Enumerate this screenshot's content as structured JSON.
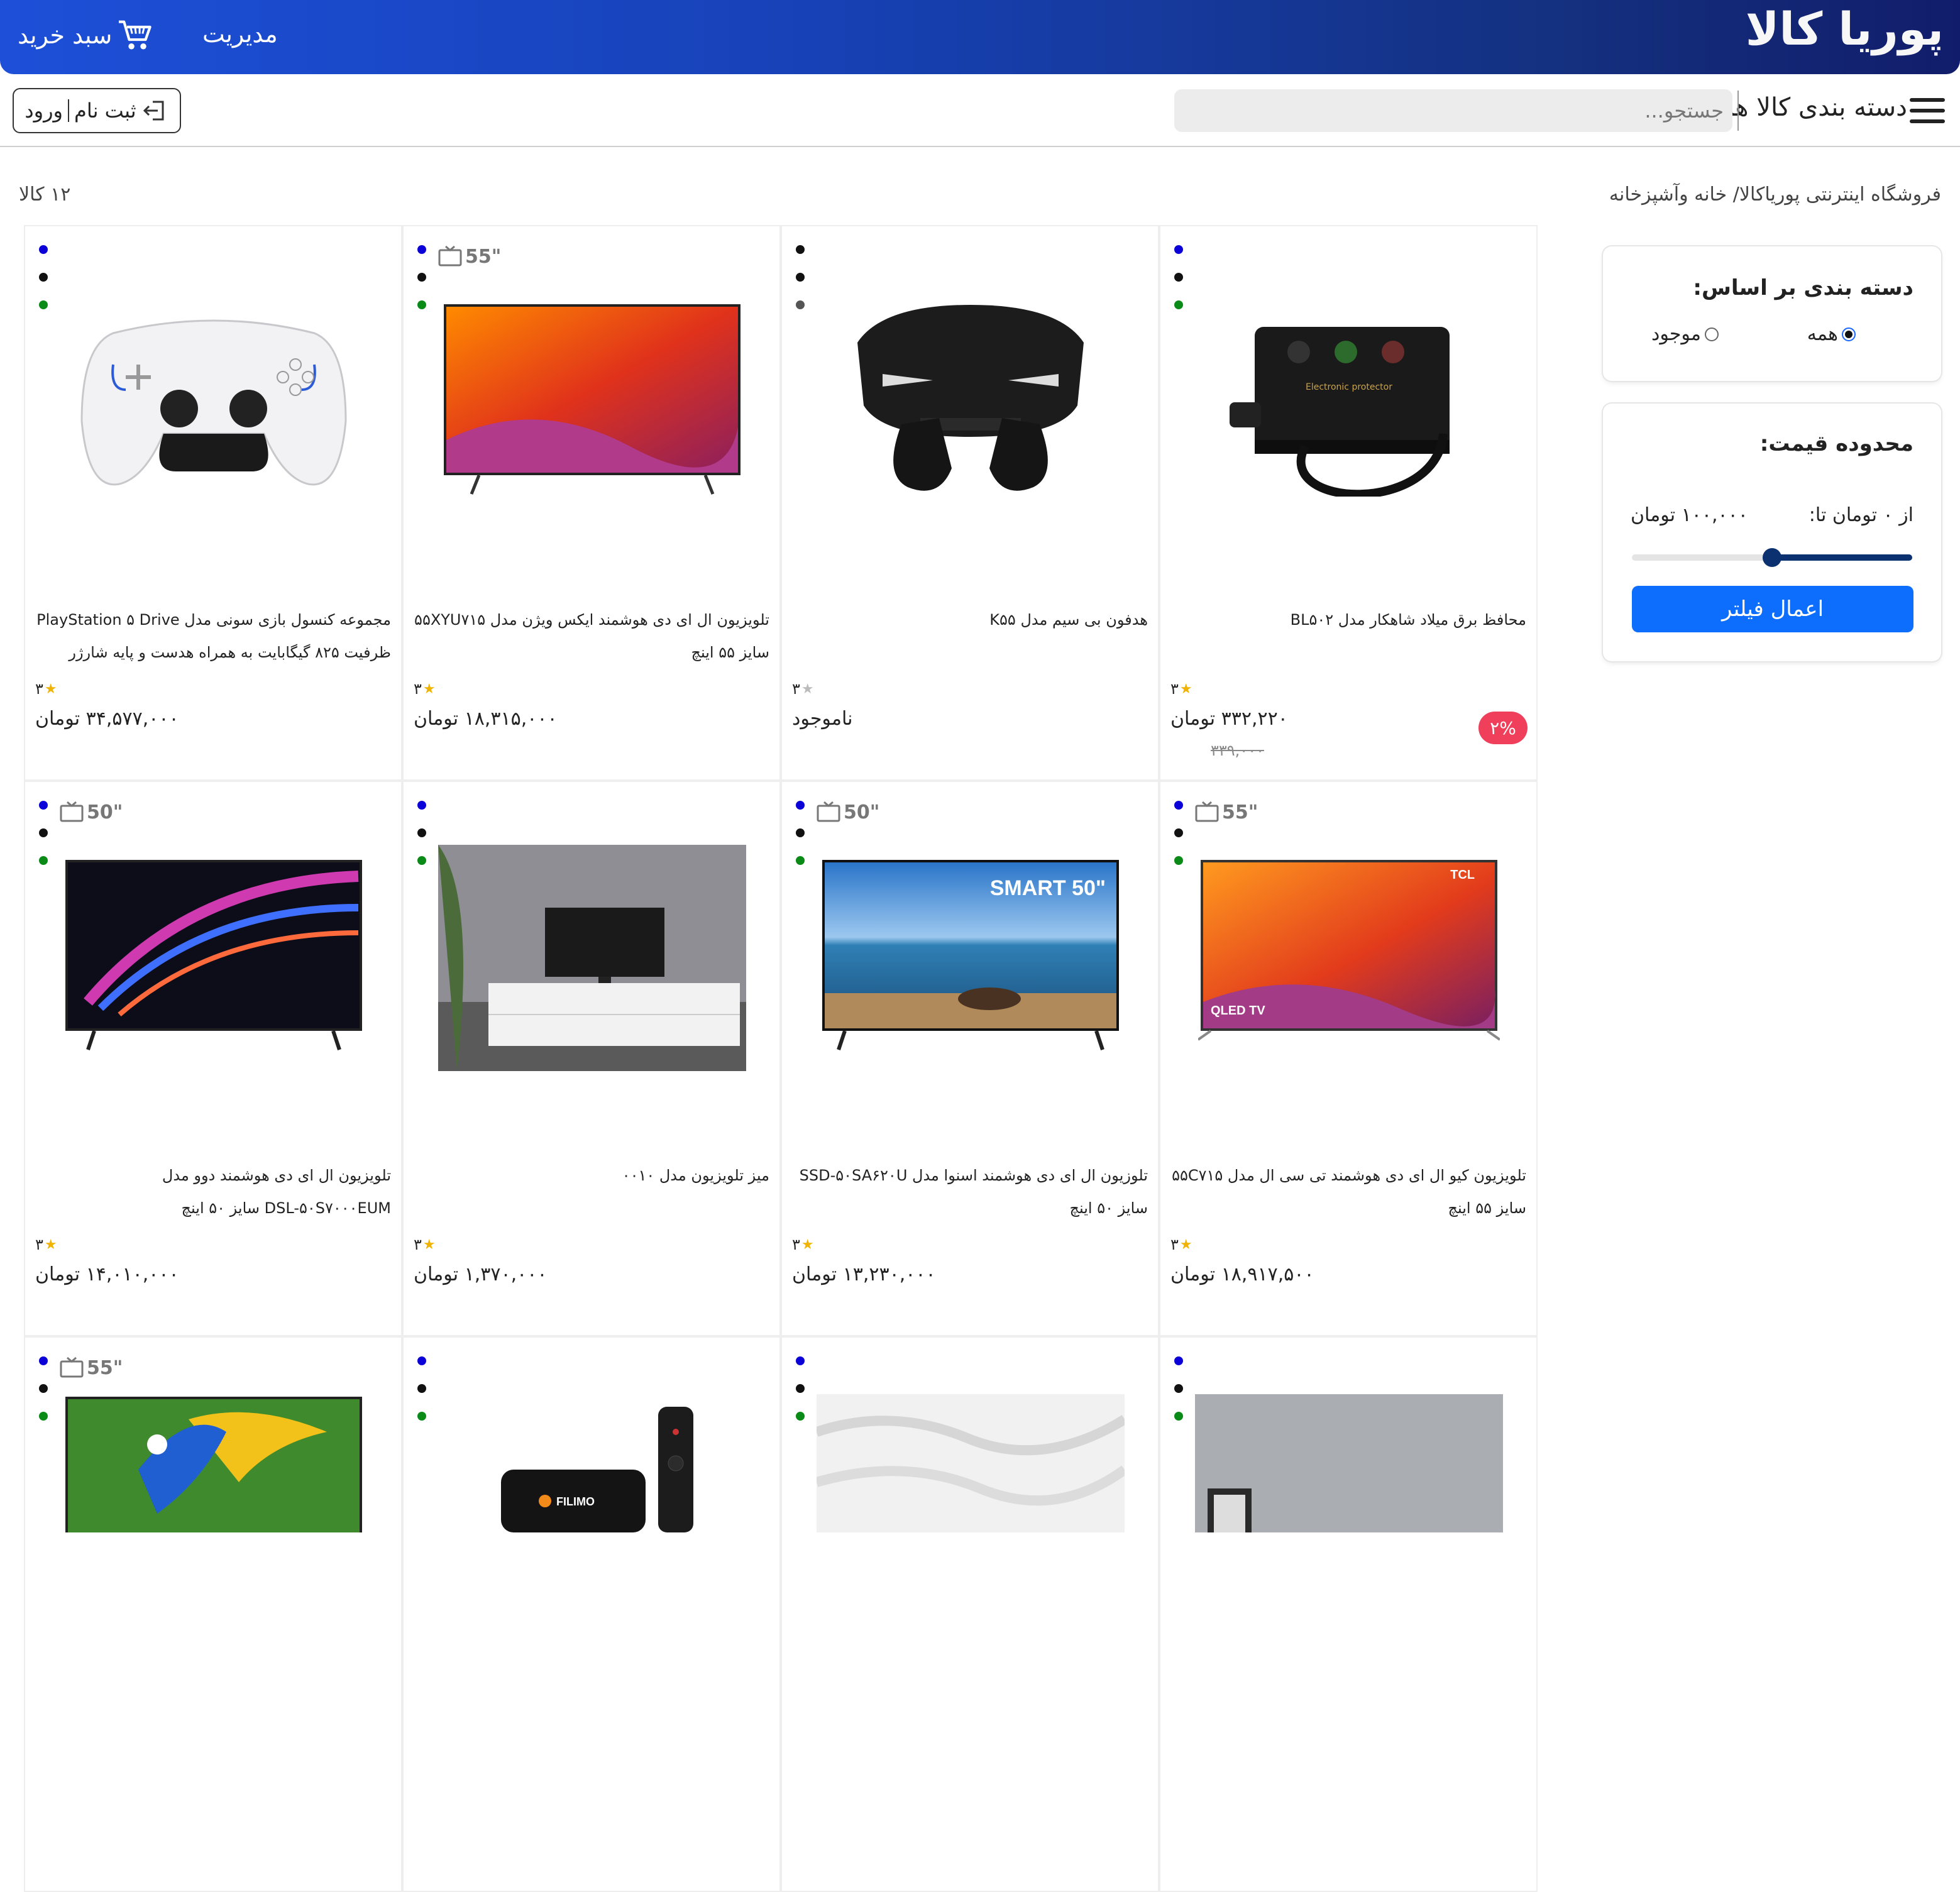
{
  "header": {
    "brand": "پوریا کالا",
    "manage_label": "مدیریت",
    "cart_label": "سبد خرید"
  },
  "subnav": {
    "categories_label": "دسته بندی کالا ها",
    "search_placeholder": "جستجو...",
    "login_label": "ورود",
    "register_label": "ثبت نام"
  },
  "page": {
    "breadcrumb": "فروشگاه اینترنتی پوریاکالا/ خانه وآشپزخانه",
    "item_count": "۱۲ کالا"
  },
  "filters": {
    "category_title": "دسته بندی بر اساس:",
    "option_all": "همه",
    "option_available": "موجود",
    "selected": "all",
    "price_title": "محدوده قیمت:",
    "range_from": "از ۰ تومان تا:",
    "range_value": "۱۰۰,۰۰۰ تومان",
    "slider_level": 0.5,
    "apply_label": "اعمال فیلتر"
  },
  "colors": {
    "accent": "#0d6efd",
    "discount": "#ef3f5b",
    "star": "#f0b400"
  },
  "products": [
    {
      "name": "محافظ برق میلاد شاهکار مدل BL۵۰۲",
      "rating": "۳",
      "price": "۳۳۲,۲۲۰ تومان",
      "old_price": "۳۳۹,۰۰۰",
      "discount": "۲%",
      "size_badge": "",
      "dots": [
        "#0b00d8",
        "#111",
        "#0a8a16"
      ],
      "image": "power-protector"
    },
    {
      "name": "هدفون بی سیم مدل K۵۵",
      "rating": "۳",
      "price": "ناموجود",
      "old_price": "",
      "discount": "",
      "size_badge": "",
      "dots": [
        "#111",
        "#111",
        "#555"
      ],
      "image": "earbuds"
    },
    {
      "name": "تلویزیون ال ای دی هوشمند ایکس ویژن مدل ۵۵XYU۷۱۵ سایز ۵۵ اینچ",
      "rating": "۳",
      "price": "۱۸,۳۱۵,۰۰۰ تومان",
      "old_price": "",
      "discount": "",
      "size_badge": "55\"",
      "dots": [
        "#0b00d8",
        "#111",
        "#0a8a16"
      ],
      "image": "tv-canyon"
    },
    {
      "name": "مجموعه کنسول بازی سونی مدل PlayStation ۵ Drive ظرفیت ۸۲۵ گیگابایت به همراه هدست و پایه شارژر",
      "rating": "۳",
      "price": "۳۴,۵۷۷,۰۰۰ تومان",
      "old_price": "",
      "discount": "",
      "size_badge": "",
      "dots": [
        "#0b00d8",
        "#111",
        "#0a8a16"
      ],
      "image": "gamepad"
    },
    {
      "name": "تلویزیون کیو ال ای دی هوشمند تی سی ال مدل ۵۵C۷۱۵ سایز ۵۵ اینچ",
      "rating": "۳",
      "price": "۱۸,۹۱۷,۵۰۰ تومان",
      "old_price": "",
      "discount": "",
      "size_badge": "55\"",
      "dots": [
        "#0b00d8",
        "#111",
        "#0a8a16"
      ],
      "image": "tv-tcl"
    },
    {
      "name": "تلوزیون ال ای دی هوشمند اسنوا مدل SSD-۵۰SA۶۲۰U سایز ۵۰ اینچ",
      "rating": "۳",
      "price": "۱۳,۲۳۰,۰۰۰ تومان",
      "old_price": "",
      "discount": "",
      "size_badge": "50\"",
      "dots": [
        "#0b00d8",
        "#111",
        "#0a8a16"
      ],
      "image": "tv-sea"
    },
    {
      "name": "میز تلویزیون مدل ۰۰۱۰",
      "rating": "۳",
      "price": "۱,۳۷۰,۰۰۰ تومان",
      "old_price": "",
      "discount": "",
      "size_badge": "",
      "dots": [
        "#0b00d8",
        "#111",
        "#0a8a16"
      ],
      "image": "tv-stand"
    },
    {
      "name": "تلویزیون ال ای دی هوشمند دوو مدل DSL-۵۰S۷۰۰۰EUM سایز ۵۰ اینچ",
      "rating": "۳",
      "price": "۱۴,۰۱۰,۰۰۰ تومان",
      "old_price": "",
      "discount": "",
      "size_badge": "50\"",
      "dots": [
        "#0b00d8",
        "#111",
        "#0a8a16"
      ],
      "image": "tv-waves"
    },
    {
      "name": "",
      "rating": "",
      "price": "",
      "old_price": "",
      "discount": "",
      "size_badge": "",
      "dots": [
        "#0b00d8",
        "#111",
        "#0a8a16"
      ],
      "image": "bed"
    },
    {
      "name": "",
      "rating": "",
      "price": "",
      "old_price": "",
      "discount": "",
      "size_badge": "",
      "dots": [
        "#0b00d8",
        "#111",
        "#0a8a16"
      ],
      "image": "duvet"
    },
    {
      "name": "",
      "rating": "",
      "price": "",
      "old_price": "",
      "discount": "",
      "size_badge": "",
      "dots": [
        "#0b00d8",
        "#111",
        "#0a8a16"
      ],
      "image": "filimo-box"
    },
    {
      "name": "",
      "rating": "",
      "price": "",
      "old_price": "",
      "discount": "",
      "size_badge": "55\"",
      "dots": [
        "#0b00d8",
        "#111",
        "#0a8a16"
      ],
      "image": "tv-parrot"
    }
  ],
  "filimo_label": "FILIMO",
  "tcl_label": "TCL",
  "qled_label": "QLED TV",
  "smart_label": "SMART 50\""
}
